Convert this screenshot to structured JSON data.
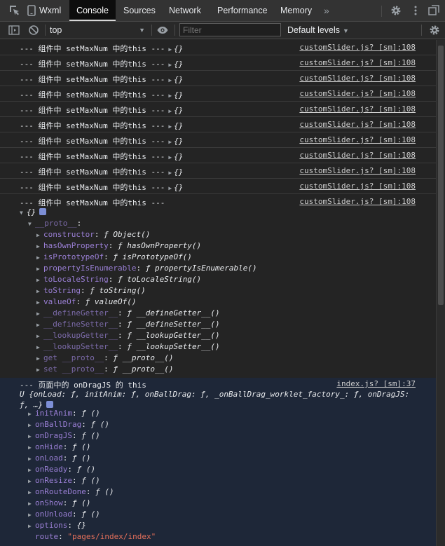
{
  "tabs": [
    {
      "label": "Wxml",
      "active": false
    },
    {
      "label": "Console",
      "active": true
    },
    {
      "label": "Sources",
      "active": false
    },
    {
      "label": "Network",
      "active": false
    },
    {
      "label": "Performance",
      "active": false
    },
    {
      "label": "Memory",
      "active": false
    }
  ],
  "toolbar": {
    "context": "top",
    "filter_placeholder": "Filter",
    "levels": "Default levels"
  },
  "log": {
    "message": "--- 组件中 setMaxNum 中的this ---",
    "collapsed_obj": "{}",
    "source": "customSlider.js? [sm]:108",
    "repeat_count": 11
  },
  "expanded": {
    "obj": "{}",
    "proto_key": "__proto__",
    "proto_items": [
      {
        "key": "constructor",
        "value": "Object()",
        "dim": false
      },
      {
        "key": "hasOwnProperty",
        "value": "hasOwnProperty()",
        "dim": false
      },
      {
        "key": "isPrototypeOf",
        "value": "isPrototypeOf()",
        "dim": false
      },
      {
        "key": "propertyIsEnumerable",
        "value": "propertyIsEnumerable()",
        "dim": false
      },
      {
        "key": "toLocaleString",
        "value": "toLocaleString()",
        "dim": false
      },
      {
        "key": "toString",
        "value": "toString()",
        "dim": false
      },
      {
        "key": "valueOf",
        "value": "valueOf()",
        "dim": false
      },
      {
        "key": "__defineGetter__",
        "value": "__defineGetter__()",
        "dim": true
      },
      {
        "key": "__defineSetter__",
        "value": "__defineSetter__()",
        "dim": true
      },
      {
        "key": "__lookupGetter__",
        "value": "__lookupGetter__()",
        "dim": true
      },
      {
        "key": "__lookupSetter__",
        "value": "__lookupSetter__()",
        "dim": true
      },
      {
        "key": "get __proto__",
        "value": "__proto__()",
        "dim": true
      },
      {
        "key": "set __proto__",
        "value": "__proto__()",
        "dim": true
      }
    ]
  },
  "group2": {
    "header": "--- 页面中的 onDragJS 的 this",
    "source": "index.js? [sm]:37",
    "summary_line1": "U {onLoad: ƒ, initAnim: ƒ, onBallDrag: ƒ, _onBallDrag_worklet_factory_: ƒ, onDragJS:",
    "summary_line2": "ƒ, …}",
    "items": [
      {
        "key": "initAnim",
        "value": "ƒ ()"
      },
      {
        "key": "onBallDrag",
        "value": "ƒ ()"
      },
      {
        "key": "onDragJS",
        "value": "ƒ ()"
      },
      {
        "key": "onHide",
        "value": "ƒ ()"
      },
      {
        "key": "onLoad",
        "value": "ƒ ()"
      },
      {
        "key": "onReady",
        "value": "ƒ ()"
      },
      {
        "key": "onResize",
        "value": "ƒ ()"
      },
      {
        "key": "onRouteDone",
        "value": "ƒ ()"
      },
      {
        "key": "onShow",
        "value": "ƒ ()"
      },
      {
        "key": "onUnload",
        "value": "ƒ ()"
      },
      {
        "key": "options",
        "value": "{}"
      }
    ],
    "route_key": "route",
    "route_value": "\"pages/index/index\""
  },
  "icons": [
    "inspect-icon",
    "device-icon",
    "more-tabs-icon",
    "settings-icon",
    "kebab-menu-icon",
    "undock-icon",
    "sidebar-toggle-icon",
    "clear-console-icon",
    "eye-icon",
    "console-settings-icon"
  ]
}
